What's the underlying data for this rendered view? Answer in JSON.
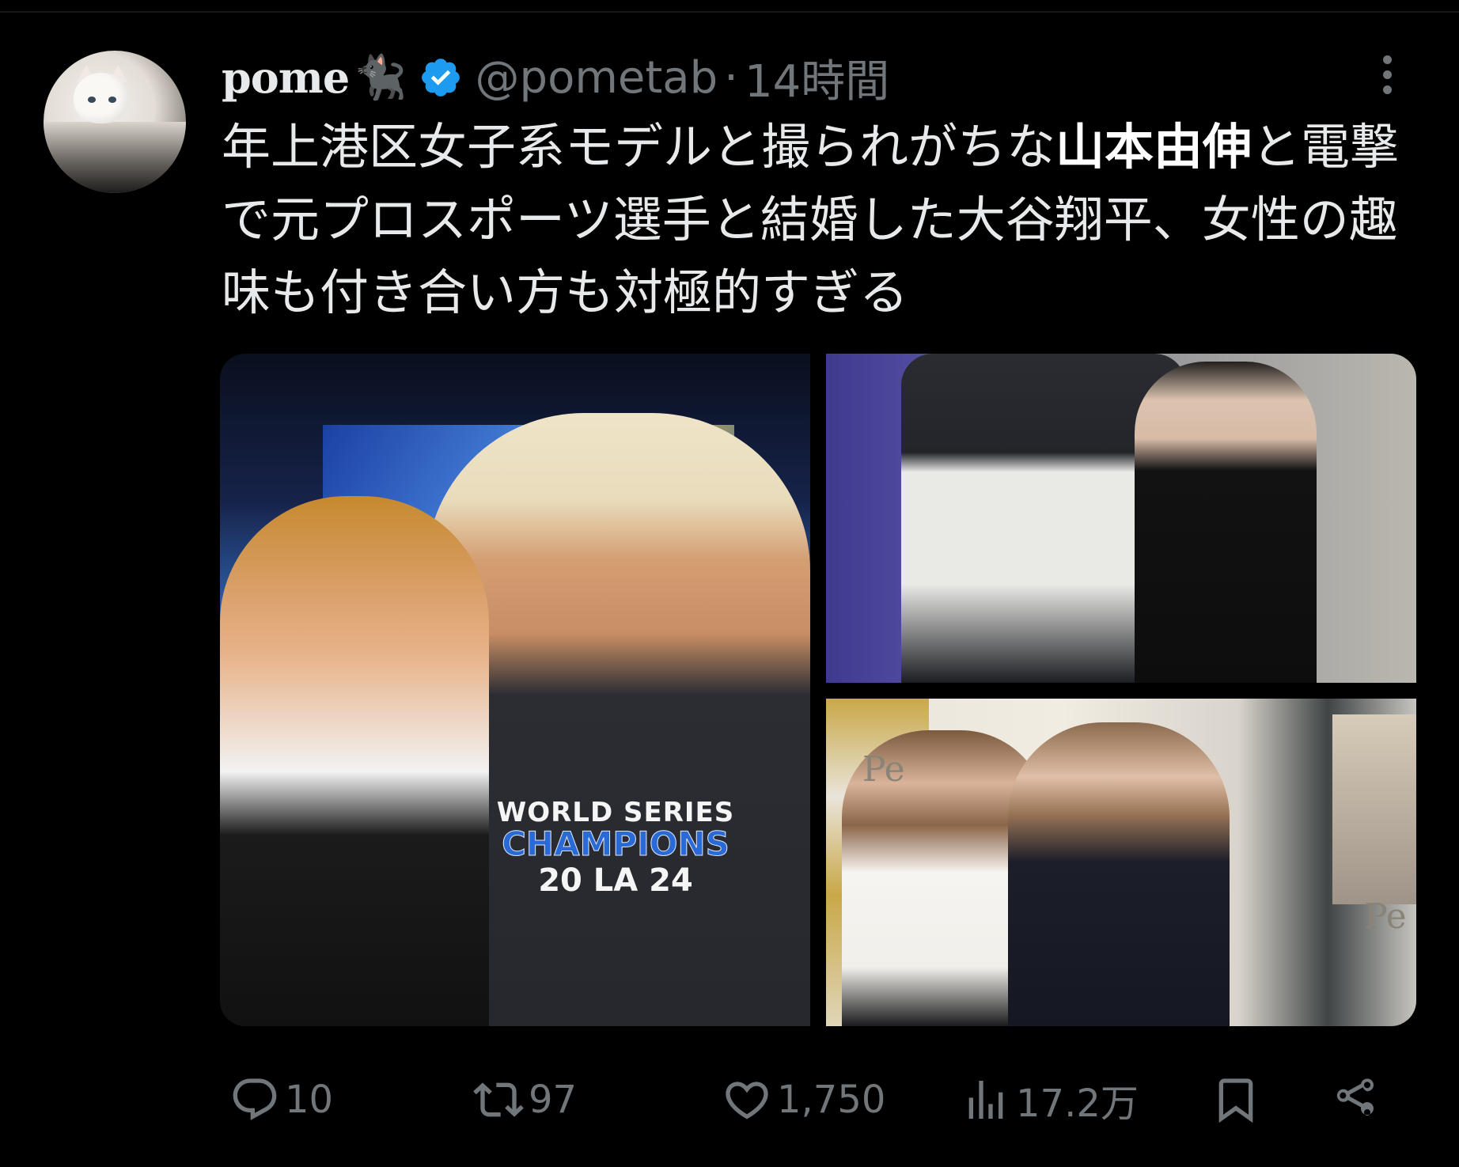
{
  "tweet": {
    "display_name": "pome",
    "name_emoji": "🐈‍⬛",
    "handle": "@pometab",
    "separator": "·",
    "time": "14時間",
    "text_part1": "年上港区女子系モデルと撮られがちな",
    "text_bold1": "山本由伸",
    "text_part2": "と電撃で元プロスポーツ選手と結婚した大谷翔平、女性の趣味も付き合い方も対極的すぎる",
    "media": {
      "shirt_line1": "WORLD SERIES",
      "shirt_line2": "CHAMPIONS",
      "shirt_line3": "20 LA 24",
      "poster_text_a": "Pe",
      "poster_text_b": "Pe"
    },
    "actions": {
      "reply_count": "10",
      "retweet_count": "97",
      "like_count": "1,750",
      "views_count": "17.2万"
    }
  },
  "colors": {
    "background": "#000000",
    "text": "#e7e9ea",
    "muted": "#71767b",
    "verified": "#1d9bf0"
  },
  "icons": [
    "verified-badge-icon",
    "more-icon",
    "reply-icon",
    "retweet-icon",
    "like-icon",
    "views-icon",
    "bookmark-icon",
    "share-icon"
  ]
}
